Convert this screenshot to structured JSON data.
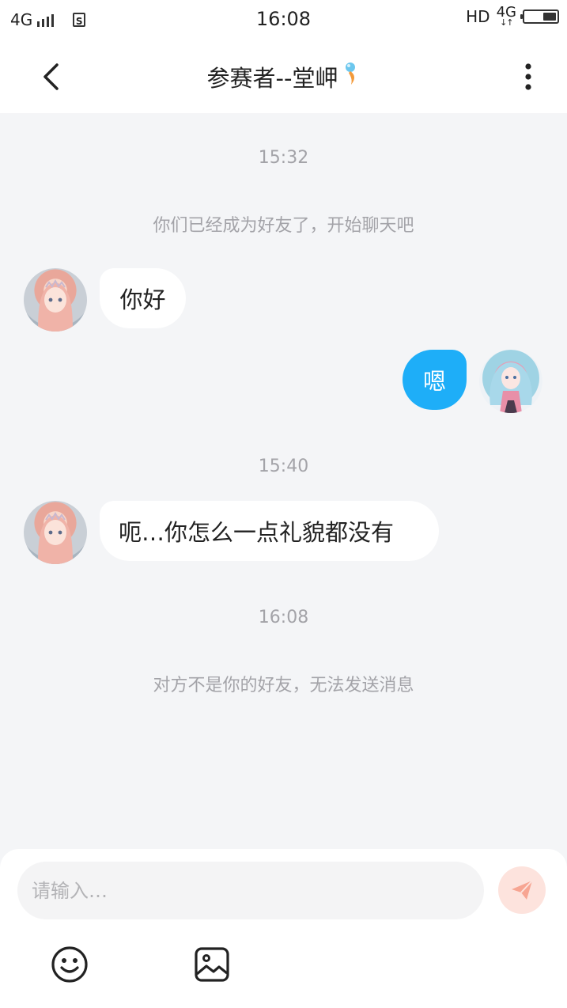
{
  "status_bar": {
    "network_left": "4G",
    "sim_label": "S",
    "time": "16:08",
    "hd_label": "HD",
    "network_right": "4G",
    "network_arrows": "↓↑"
  },
  "header": {
    "title": "参赛者--堂岬",
    "back_icon": "chevron-left-icon",
    "more_icon": "vertical-dots-icon"
  },
  "chat": {
    "timestamps": [
      "15:32",
      "15:40",
      "16:08"
    ],
    "system_messages": [
      "你们已经成为好友了，开始聊天吧",
      "对方不是你的好友，无法发送消息"
    ],
    "messages": [
      {
        "side": "left",
        "text": "你好"
      },
      {
        "side": "right",
        "text": "嗯"
      },
      {
        "side": "left",
        "text": "呃…你怎么一点礼貌都没有"
      }
    ]
  },
  "composer": {
    "placeholder": "请输入…",
    "value": "",
    "send_icon": "paper-plane-icon",
    "emoji_icon": "smiley-icon",
    "image_icon": "image-icon"
  },
  "colors": {
    "background": "#f4f5f7",
    "outgoing_bubble": "#1eaef8",
    "incoming_bubble": "#ffffff",
    "muted_text": "#a3a3a8",
    "send_button_bg": "#fde3dd",
    "send_button_icon": "#f7a592"
  }
}
